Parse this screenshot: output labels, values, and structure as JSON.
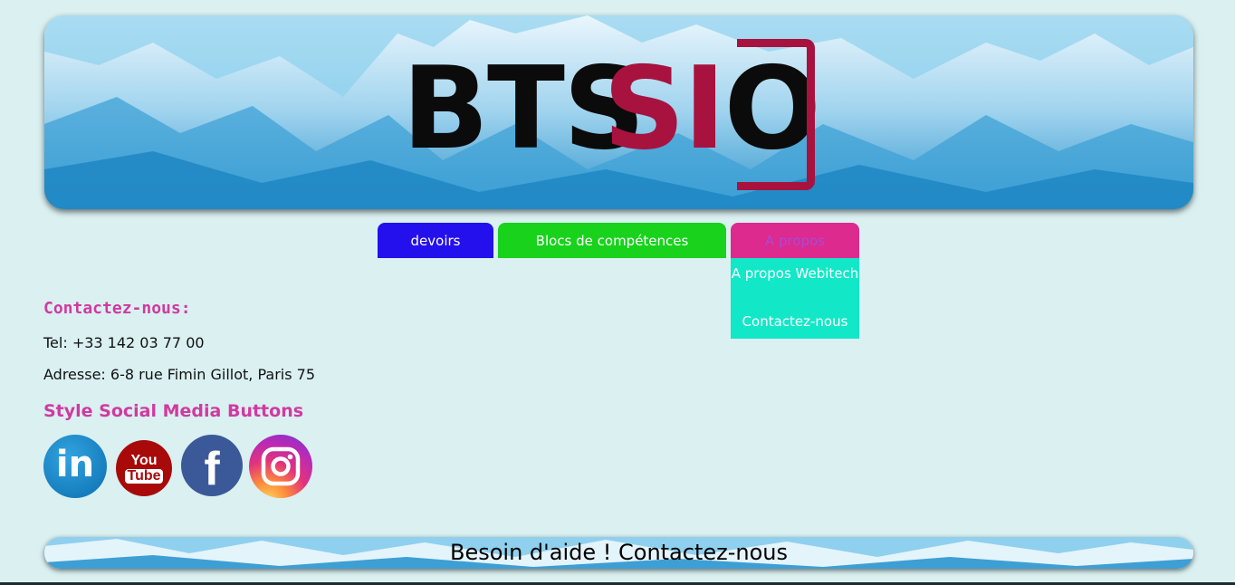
{
  "banner": {
    "logo_part1": "BTS",
    "logo_part2": "SI",
    "logo_part3": "O",
    "logo_color_dark": "#0b0b0b",
    "logo_color_accent": "#a8123e"
  },
  "nav": {
    "items": [
      {
        "label": "devoirs",
        "color": "#2410ec"
      },
      {
        "label": "Blocs de compétences",
        "color": "#18d21c"
      },
      {
        "label": "A propos",
        "color": "#dc2a8f"
      }
    ],
    "dropdown": {
      "items": [
        {
          "label": "A propos Webitech"
        },
        {
          "label": "Contactez-nous"
        }
      ],
      "color": "#12e8c8"
    }
  },
  "contact": {
    "heading": "Contactez-nous:",
    "tel": "Tel: +33 142 03 77 00",
    "address": "Adresse: 6-8 rue Fimin Gillot, Paris 75"
  },
  "social": {
    "heading": "Style Social Media Buttons",
    "icons": [
      "linkedin-icon",
      "youtube-icon",
      "facebook-icon",
      "instagram-icon"
    ],
    "linkedin_text": "in",
    "youtube_top": "You",
    "youtube_bottom": "Tube",
    "facebook_text": "f"
  },
  "footer": {
    "text": "Besoin d'aide ! Contactez-nous"
  },
  "colors": {
    "background": "#daf0f1",
    "heading": "#d03aa0"
  }
}
